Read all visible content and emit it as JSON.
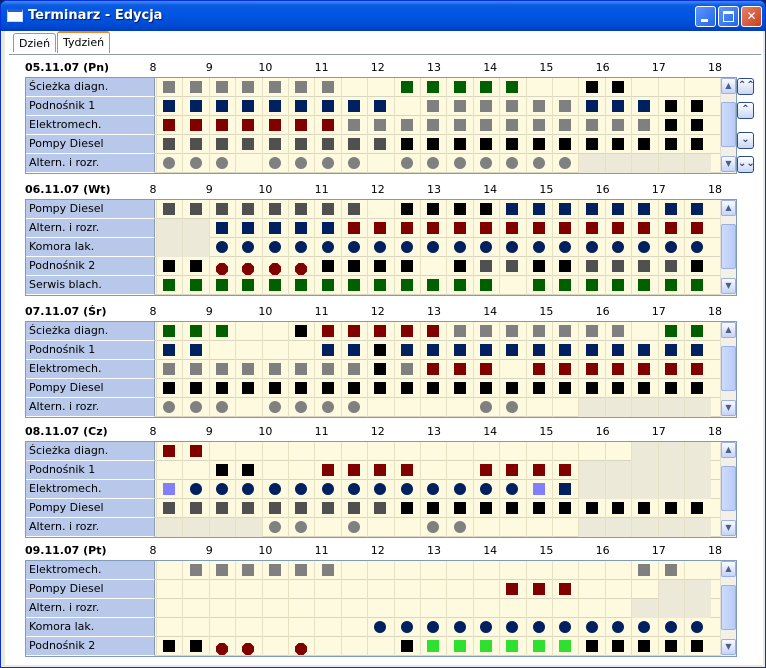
{
  "window": {
    "title": "Terminarz - Edycja",
    "min": "",
    "max": "",
    "close": "✕"
  },
  "tabs": [
    {
      "label": "Dzień"
    },
    {
      "label": "Tydzień"
    }
  ],
  "hours": [
    "8",
    "9",
    "10",
    "11",
    "12",
    "13",
    "14",
    "15",
    "16",
    "17",
    "18"
  ],
  "colors": {
    "gray": "#808080",
    "blue": "#002060",
    "red": "#800000",
    "green": "#006000",
    "black": "#000000",
    "dgray": "#505050",
    "lime": "#30e030",
    "lblue": "#8080ff"
  },
  "nav": [
    "⌃⌃",
    "⌃",
    "⌄",
    "⌄⌄"
  ],
  "days": [
    {
      "label": "05.11.07 (Pn)",
      "rows": [
        {
          "name": "Ścieżka diagn.",
          "cells": [
            "gs",
            "gs",
            "gs",
            "gs",
            "gs",
            "gs",
            "gs",
            "",
            "",
            "Gs",
            "Gs",
            "Gs",
            "Gs",
            "Gs",
            "",
            "",
            "ks",
            "ks",
            "",
            "",
            ""
          ],
          "gray": []
        },
        {
          "name": "Podnośnik 1",
          "cells": [
            "bs",
            "bs",
            "bs",
            "bs",
            "bs",
            "bs",
            "bs",
            "bs",
            "bs",
            "",
            "gs",
            "gs",
            "gs",
            "gs",
            "gs",
            "gs",
            "bs",
            "bs",
            "bs",
            "ks",
            "ks"
          ],
          "gray": []
        },
        {
          "name": "Elektromech.",
          "cells": [
            "rs",
            "rs",
            "rs",
            "rs",
            "rs",
            "rs",
            "rs",
            "gs",
            "gs",
            "gs",
            "gs",
            "gs",
            "gs",
            "gs",
            "gs",
            "gs",
            "gs",
            "gs",
            "gs",
            "ks",
            "ks"
          ],
          "gray": []
        },
        {
          "name": "Pompy Diesel",
          "cells": [
            "ds",
            "ds",
            "ds",
            "ds",
            "ds",
            "ds",
            "ds",
            "ds",
            "ds",
            "ks",
            "ks",
            "ks",
            "ks",
            "ks",
            "ks",
            "ks",
            "ks",
            "ks",
            "ks",
            "ks",
            "ks"
          ],
          "gray": []
        },
        {
          "name": "Altern. i rozr.",
          "cells": [
            "gc",
            "gc",
            "gc",
            "",
            "gc",
            "gc",
            "gc",
            "gc",
            "",
            "gc",
            "gc",
            "gc",
            "gc",
            "gc",
            "gc",
            "gc",
            "",
            "",
            "",
            "",
            ""
          ],
          "gray": [
            16,
            17,
            18,
            19,
            20
          ]
        }
      ]
    },
    {
      "label": "06.11.07 (Wt)",
      "rows": [
        {
          "name": "Pompy Diesel",
          "cells": [
            "ds",
            "ds",
            "ds",
            "ds",
            "ds",
            "ds",
            "ds",
            "ds",
            "",
            "ks",
            "ks",
            "ks",
            "ks",
            "bs",
            "bs",
            "bs",
            "bs",
            "bs",
            "bs",
            "bs",
            "bs"
          ],
          "gray": []
        },
        {
          "name": "Altern. i rozr.",
          "cells": [
            "",
            "",
            "bs",
            "bs",
            "bs",
            "bs",
            "bs",
            "rs",
            "rs",
            "rs",
            "rs",
            "rs",
            "rs",
            "rs",
            "rs",
            "rs",
            "rs",
            "rs",
            "rs",
            "rs",
            "rs"
          ],
          "gray": [
            0,
            1
          ]
        },
        {
          "name": "Komora lak.",
          "cells": [
            "",
            "",
            "bc",
            "bc",
            "bc",
            "bc",
            "bc",
            "bc",
            "bc",
            "bc",
            "bc",
            "bc",
            "bc",
            "bc",
            "bc",
            "bc",
            "bc",
            "bc",
            "bc",
            "bc",
            "bc"
          ],
          "gray": [
            0,
            1
          ]
        },
        {
          "name": "Podnośnik 2",
          "cells": [
            "ks",
            "ks",
            "rh",
            "rh",
            "rh",
            "rh",
            "ks",
            "ks",
            "ks",
            "ks",
            "",
            "ks",
            "ds",
            "ds",
            "ks",
            "ks",
            "ds",
            "ds",
            "ds",
            "ds",
            "ks"
          ],
          "gray": []
        },
        {
          "name": "Serwis blach.",
          "cells": [
            "Gs",
            "Gs",
            "Gs",
            "Gs",
            "Gs",
            "Gs",
            "Gs",
            "Gs",
            "Gs",
            "Gs",
            "Gs",
            "Gs",
            "Gs",
            "",
            "Gs",
            "Gs",
            "Gs",
            "Gs",
            "Gs",
            "Gs",
            "Gs"
          ],
          "gray": []
        }
      ]
    },
    {
      "label": "07.11.07 (Śr)",
      "rows": [
        {
          "name": "Ścieżka diagn.",
          "cells": [
            "Gs",
            "Gs",
            "Gs",
            "",
            "",
            "ks",
            "rs",
            "rs",
            "rs",
            "rs",
            "rs",
            "gs",
            "gs",
            "gs",
            "gs",
            "gs",
            "gs",
            "gs",
            "",
            "Gs",
            "Gs"
          ],
          "gray": []
        },
        {
          "name": "Podnośnik 1",
          "cells": [
            "bs",
            "bs",
            "",
            "",
            "",
            "",
            "bs",
            "bs",
            "ks",
            "bs",
            "bs",
            "bs",
            "bs",
            "bs",
            "bs",
            "bs",
            "bs",
            "bs",
            "bs",
            "bs",
            "bs"
          ],
          "gray": []
        },
        {
          "name": "Elektromech.",
          "cells": [
            "gs",
            "gs",
            "gs",
            "gs",
            "gs",
            "gs",
            "gs",
            "gs",
            "ks",
            "gs",
            "rs",
            "rs",
            "rs",
            "",
            "rs",
            "rs",
            "rs",
            "rs",
            "rs",
            "rs",
            "rs"
          ],
          "gray": []
        },
        {
          "name": "Pompy Diesel",
          "cells": [
            "ks",
            "ks",
            "ks",
            "ks",
            "ks",
            "ks",
            "ks",
            "ks",
            "ks",
            "ks",
            "ks",
            "ks",
            "ks",
            "ks",
            "ks",
            "ks",
            "ks",
            "ks",
            "ks",
            "ks",
            "ks"
          ],
          "gray": []
        },
        {
          "name": "Altern. i rozr.",
          "cells": [
            "gc",
            "gc",
            "gc",
            "",
            "gc",
            "gc",
            "gc",
            "gc",
            "",
            "",
            "",
            "",
            "gc",
            "gc",
            "",
            "",
            "",
            "",
            "",
            "",
            ""
          ],
          "gray": [
            16,
            17,
            18,
            19,
            20
          ]
        }
      ]
    },
    {
      "label": "08.11.07 (Cz)",
      "rows": [
        {
          "name": "Ścieżka diagn.",
          "cells": [
            "rs",
            "rs",
            "",
            "",
            "",
            "",
            "",
            "",
            "",
            "",
            "",
            "",
            "",
            "",
            "",
            "",
            "",
            "",
            "",
            "",
            ""
          ],
          "gray": [
            18,
            19,
            20
          ]
        },
        {
          "name": "Podnośnik 1",
          "cells": [
            "",
            "",
            "ks",
            "ks",
            "",
            "",
            "rs",
            "rs",
            "rs",
            "rs",
            "",
            "",
            "rs",
            "rs",
            "rs",
            "rs",
            "",
            "",
            "",
            "",
            ""
          ],
          "gray": [
            16,
            17,
            18,
            19,
            20
          ]
        },
        {
          "name": "Elektromech.",
          "cells": [
            "ls",
            "bc",
            "bc",
            "bc",
            "bc",
            "bc",
            "bc",
            "bc",
            "bc",
            "bc",
            "bc",
            "bc",
            "bc",
            "bc",
            "ls",
            "bs",
            "",
            "",
            "",
            "",
            ""
          ],
          "gray": [
            16,
            17,
            18,
            19,
            20
          ]
        },
        {
          "name": "Pompy Diesel",
          "cells": [
            "ds",
            "ds",
            "ds",
            "ds",
            "ds",
            "ds",
            "ds",
            "ds",
            "ds",
            "ks",
            "ks",
            "ks",
            "ks",
            "ks",
            "ks",
            "ks",
            "ks",
            "ks",
            "ks",
            "ks",
            "ks"
          ],
          "gray": []
        },
        {
          "name": "Altern. i rozr.",
          "cells": [
            "",
            "",
            "",
            "",
            "gc",
            "gc",
            "",
            "gc",
            "",
            "",
            "gc",
            "gc",
            "",
            "",
            "",
            "",
            "",
            "",
            "",
            "",
            ""
          ],
          "gray": [
            0,
            1,
            2,
            3,
            16,
            17,
            18,
            19,
            20
          ]
        }
      ]
    },
    {
      "label": "09.11.07 (Pt)",
      "rows": [
        {
          "name": "Elektromech.",
          "cells": [
            "",
            "gs",
            "gs",
            "gs",
            "gs",
            "gs",
            "gs",
            "",
            "",
            "",
            "",
            "",
            "",
            "",
            "",
            "",
            "",
            "",
            "gs",
            "gs",
            ""
          ],
          "gray": []
        },
        {
          "name": "Pompy Diesel",
          "cells": [
            "",
            "",
            "",
            "",
            "",
            "",
            "",
            "",
            "",
            "",
            "",
            "",
            "",
            "rs",
            "rs",
            "rs",
            "",
            "",
            "",
            "",
            ""
          ],
          "gray": [
            19,
            20
          ]
        },
        {
          "name": "Altern. i rozr.",
          "cells": [
            "",
            "",
            "",
            "",
            "",
            "",
            "",
            "",
            "",
            "",
            "",
            "",
            "",
            "",
            "",
            "",
            "",
            "",
            "",
            "",
            ""
          ],
          "gray": [
            18,
            19,
            20
          ]
        },
        {
          "name": "Komora lak.",
          "cells": [
            "",
            "",
            "",
            "",
            "",
            "",
            "",
            "",
            "bc",
            "bc",
            "bc",
            "bc",
            "bc",
            "bc",
            "bc",
            "bc",
            "bc",
            "bc",
            "bc",
            "bc",
            "bc"
          ],
          "gray": []
        },
        {
          "name": "Podnośnik 2",
          "cells": [
            "ks",
            "ks",
            "rh",
            "rh",
            "",
            "rh",
            "",
            "",
            "",
            "ks",
            "Ls",
            "Ls",
            "Ls",
            "Ls",
            "Ls",
            "Ls",
            "ks",
            "ks",
            "ks",
            "ks",
            "ks"
          ],
          "gray": []
        }
      ]
    }
  ]
}
